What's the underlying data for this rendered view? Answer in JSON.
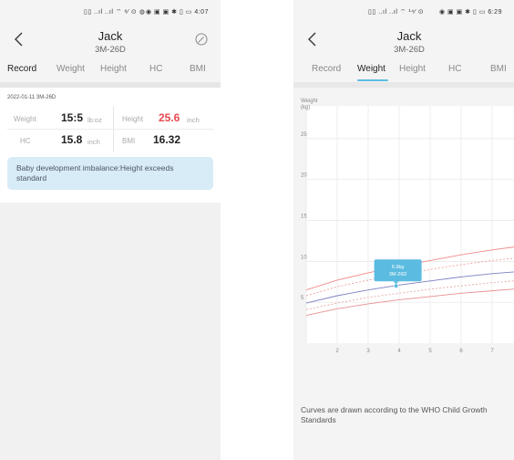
{
  "left": {
    "status": {
      "left": "▯▯ ..ıl ..ıl ⌔ ⁸⁄ ⊙ ◍",
      "right": "◉ ▣ ▣ ✱ ▯ ▭ 4:07"
    },
    "child": {
      "name": "Jack",
      "age": "3M-26D"
    },
    "tabs": [
      "Record",
      "Weight",
      "Height",
      "HC",
      "BMI"
    ],
    "active_tab": "Record",
    "record": {
      "date": "2022-01-11",
      "age": "3M-26D",
      "weight": {
        "label": "Weight",
        "value": "15:5",
        "unit": "lb:oz"
      },
      "height": {
        "label": "Height",
        "value": "25.6",
        "unit": "inch",
        "color": "#e8484f"
      },
      "hc": {
        "label": "HC",
        "value": "15.8",
        "unit": "inch"
      },
      "bmi": {
        "label": "BMI",
        "value": "16.32"
      }
    },
    "alert": "Baby development imbalance:Height exceeds standard"
  },
  "right": {
    "status": {
      "left": "▯▯ ..ıl ..ıl ⌔ ¹⁴⁄ ⊙",
      "right": "◉ ▣ ▣ ✱ ▯ ▭ 6:29"
    },
    "child": {
      "name": "Jack",
      "age": "3M-26D"
    },
    "tabs": [
      "Record",
      "Weight",
      "Height",
      "HC",
      "BMI"
    ],
    "active_tab": "Weight",
    "chart_note": "Curves are drawn according to the WHO Child Growth Standards"
  },
  "chart_data": {
    "type": "line",
    "ylabel": "Weight\n(kg)",
    "x": [
      1,
      2,
      3,
      4,
      5,
      6,
      7,
      8
    ],
    "x_ticks": [
      2,
      3,
      4,
      5,
      6,
      7
    ],
    "y_ticks": [
      5,
      10,
      15,
      20,
      25
    ],
    "xlim": [
      1,
      8
    ],
    "ylim": [
      0,
      29
    ],
    "grid": true,
    "series": [
      {
        "values": [
          6.5,
          7.7,
          8.6,
          9.4,
          10.1,
          10.8,
          11.4,
          11.9
        ],
        "color": "#f08a8a",
        "dash": false
      },
      {
        "values": [
          5.8,
          6.9,
          7.7,
          8.4,
          9.0,
          9.6,
          10.1,
          10.5
        ],
        "color": "#f0a0a0",
        "dash": true
      },
      {
        "values": [
          4.9,
          5.8,
          6.5,
          7.1,
          7.6,
          8.1,
          8.5,
          8.8
        ],
        "color": "#7d7fc4",
        "dash": false
      },
      {
        "values": [
          4.1,
          4.9,
          5.6,
          6.1,
          6.6,
          7.0,
          7.4,
          7.7
        ],
        "color": "#e8a8a8",
        "dash": true
      },
      {
        "values": [
          3.4,
          4.2,
          4.8,
          5.3,
          5.7,
          6.1,
          6.4,
          6.7
        ],
        "color": "#e89090",
        "dash": false
      }
    ],
    "point": {
      "x": 3.9,
      "y": 7.0,
      "label": "6.9kg",
      "sublabel": "3M-26D"
    },
    "colors": {
      "point": "#5bbbe0",
      "tooltip": "#5bbbe0"
    }
  }
}
